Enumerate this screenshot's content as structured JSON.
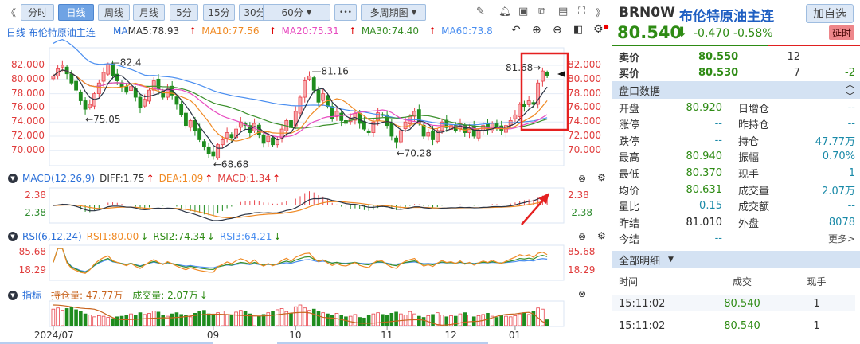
{
  "toolbar": {
    "collapse": "《",
    "tabs": [
      "分时",
      "日线",
      "周线",
      "月线",
      "5分",
      "15分",
      "30分"
    ],
    "tab_60": "60分",
    "more": "•••",
    "multi": "多周期图",
    "expand": "》",
    "active": "日线"
  },
  "ma_bar": {
    "title": "日线 布伦特原油主连",
    "ma": "MA",
    "ma5": "MA5:78.93",
    "ma10": "MA10:77.56",
    "ma20": "MA20:75.31",
    "ma30": "MA30:74.40",
    "ma60": "MA60:73.8",
    "up_arrow": "↑"
  },
  "colors": {
    "up": "#e8434b",
    "down": "#1e8c1e",
    "ma5": "#2b3445",
    "ma10": "#f08a24",
    "ma20": "#e84bc0",
    "ma30": "#3a8f2a",
    "ma60": "#4a8ef0",
    "accent": "#2a6fd8"
  },
  "macd": {
    "title": "MACD(12,26,9)",
    "diff": "DIFF:1.75",
    "dea": "DEA:1.09",
    "macd": "MACD:1.34",
    "top": "2.38",
    "bottom": "-2.38"
  },
  "rsi": {
    "title": "RSI(6,12,24)",
    "rsi1": "RSI1:80.00",
    "rsi2": "RSI2:74.34",
    "rsi3": "RSI3:64.21",
    "top": "85.68",
    "bottom": "18.29"
  },
  "ind": {
    "title": "指标",
    "oi": "持仓量: 47.77万",
    "vol": "成交量: 2.07万"
  },
  "chart_data": {
    "type": "candlestick",
    "y_ticks": [
      "82.000",
      "80.000",
      "78.000",
      "76.000",
      "74.000",
      "72.000",
      "70.000"
    ],
    "y_tick_values": [
      82,
      80,
      78,
      76,
      74,
      72,
      70
    ],
    "x_labels": [
      {
        "label": "2024/07",
        "index": 0
      },
      {
        "label": "09",
        "index": 35
      },
      {
        "label": "10",
        "index": 53
      },
      {
        "label": "11",
        "index": 73
      },
      {
        "label": "12",
        "index": 87
      },
      {
        "label": "01",
        "index": 101
      }
    ],
    "close": [
      80.5,
      81.5,
      82.0,
      80.8,
      79.5,
      78.5,
      77.0,
      75.8,
      76.5,
      78.0,
      79.5,
      81.0,
      82.2,
      80.5,
      79.8,
      79.0,
      78.2,
      79.0,
      77.5,
      76.0,
      77.2,
      78.5,
      79.8,
      78.6,
      77.5,
      78.8,
      77.8,
      76.5,
      75.0,
      73.5,
      74.2,
      72.8,
      71.5,
      70.5,
      69.5,
      69.2,
      70.8,
      71.5,
      72.5,
      71.8,
      73.0,
      74.0,
      73.5,
      72.5,
      73.8,
      72.2,
      71.0,
      72.0,
      70.8,
      71.5,
      73.0,
      74.2,
      73.2,
      75.5,
      77.5,
      79.8,
      80.5,
      78.5,
      76.8,
      78.0,
      76.2,
      74.5,
      75.5,
      74.2,
      73.8,
      74.5,
      75.2,
      73.8,
      73.0,
      72.5,
      74.0,
      75.3,
      75.0,
      73.5,
      72.0,
      71.2,
      72.8,
      74.0,
      74.8,
      75.5,
      73.8,
      72.0,
      72.5,
      71.5,
      72.8,
      74.0,
      73.2,
      73.5,
      72.8,
      73.8,
      72.5,
      73.2,
      72.0,
      72.8,
      73.5,
      73.0,
      73.8,
      73.2,
      72.8,
      73.5,
      74.2,
      75.0,
      76.5,
      76.2,
      77.0,
      76.5,
      79.5,
      81.2,
      80.5
    ],
    "volume": [
      28,
      30,
      26,
      29,
      31,
      27,
      24,
      20,
      18,
      15,
      17,
      16,
      14,
      12,
      15,
      16,
      18,
      20,
      17,
      22,
      19,
      21,
      25,
      23,
      18,
      16,
      20,
      22,
      19,
      17,
      15,
      21,
      24,
      26,
      20,
      18,
      22,
      25,
      19,
      17,
      23,
      26,
      24,
      20,
      18,
      16,
      19,
      22,
      25,
      27,
      29,
      24,
      21,
      32,
      35,
      30,
      26,
      28,
      24,
      22,
      20,
      18,
      21,
      17,
      15,
      16,
      19,
      14,
      13,
      17,
      20,
      22,
      19,
      18,
      21,
      23,
      20,
      18,
      24,
      20,
      16,
      14,
      17,
      19,
      22,
      18,
      15,
      17,
      16,
      20,
      22,
      18,
      15,
      17,
      19,
      21,
      16,
      14,
      18,
      16,
      15,
      17,
      20,
      22,
      19,
      25,
      30,
      28,
      10
    ],
    "open_interest": [
      [
        0,
        52
      ],
      [
        8,
        50
      ],
      [
        15,
        44
      ],
      [
        25,
        45
      ],
      [
        35,
        47
      ],
      [
        45,
        46
      ],
      [
        55,
        48
      ],
      [
        60,
        45
      ],
      [
        68,
        42
      ],
      [
        80,
        44
      ],
      [
        85,
        41
      ],
      [
        92,
        43
      ],
      [
        100,
        47
      ],
      [
        104,
        48
      ],
      [
        108,
        42
      ]
    ],
    "annotations": [
      {
        "index": 12,
        "value": 82.4,
        "text": "82.4",
        "side": "high"
      },
      {
        "index": 7,
        "value": 75.05,
        "text": "←75.05",
        "side": "low"
      },
      {
        "index": 35,
        "value": 68.68,
        "text": "←68.68",
        "side": "low"
      },
      {
        "index": 56,
        "value": 81.16,
        "text": "81.16",
        "side": "high"
      },
      {
        "index": 75,
        "value": 70.28,
        "text": "←70.28",
        "side": "low"
      },
      {
        "index": 107,
        "value": 81.68,
        "text": "81.68→",
        "side": "high"
      }
    ]
  },
  "quote": {
    "code": "BRN0W",
    "name": "布伦特原油主连",
    "add": "加自选",
    "price": "80.540",
    "change": "-0.470",
    "pct": "-0.58%",
    "delay": "延时",
    "arrow": "🡇"
  },
  "book": [
    {
      "k": "卖价",
      "p": "80.550",
      "q": "12",
      "d": ""
    },
    {
      "k": "买价",
      "p": "80.530",
      "q": "7",
      "d": "-2"
    }
  ],
  "panel": {
    "title": "盘口数据",
    "rows": [
      {
        "k": "开盘",
        "v": "80.920",
        "c": "g",
        "k2": "日增仓",
        "v2": "--"
      },
      {
        "k": "涨停",
        "v": "--",
        "c": "b",
        "k2": "昨持仓",
        "v2": "--"
      },
      {
        "k": "跌停",
        "v": "--",
        "c": "b",
        "k2": "持仓",
        "v2": "47.77万"
      },
      {
        "k": "最高",
        "v": "80.940",
        "c": "g",
        "k2": "振幅",
        "v2": "0.70%"
      },
      {
        "k": "最低",
        "v": "80.370",
        "c": "g",
        "k2": "现手",
        "v2": "1"
      },
      {
        "k": "均价",
        "v": "80.631",
        "c": "g",
        "k2": "成交量",
        "v2": "2.07万"
      },
      {
        "k": "量比",
        "v": "0.15",
        "c": "b",
        "k2": "成交额",
        "v2": "--"
      },
      {
        "k": "昨结",
        "v": "81.010",
        "c": "d",
        "k2": "外盘",
        "v2": "8078"
      },
      {
        "k": "今结",
        "v": "--",
        "c": "b",
        "k2": "",
        "v2": "更多>"
      }
    ]
  },
  "detail": {
    "title": "全部明细",
    "cols": [
      "时间",
      "成交",
      "现手"
    ],
    "rows": [
      {
        "t": "15:11:02",
        "p": "80.540",
        "q": "1"
      },
      {
        "t": "15:11:02",
        "p": "80.540",
        "q": "1"
      }
    ]
  }
}
